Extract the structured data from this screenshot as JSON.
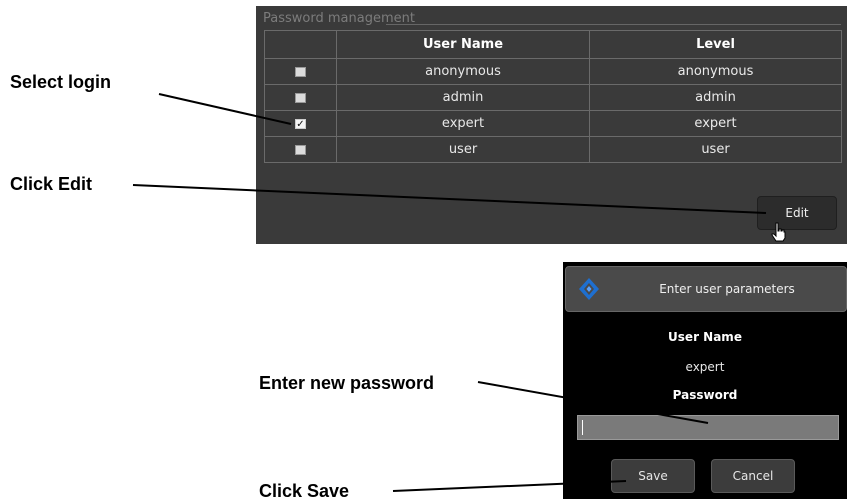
{
  "password_management": {
    "title": "Password management",
    "columns": [
      "User Name",
      "Level"
    ],
    "rows": [
      {
        "user": "anonymous",
        "level": "anonymous",
        "checked": false
      },
      {
        "user": "admin",
        "level": "admin",
        "checked": false
      },
      {
        "user": "expert",
        "level": "expert",
        "checked": true
      },
      {
        "user": "user",
        "level": "user",
        "checked": false
      }
    ],
    "edit_label": "Edit"
  },
  "dialog": {
    "title": "Enter user parameters",
    "user_name_label": "User Name",
    "user_name_value": "expert",
    "password_label": "Password",
    "password_value": "",
    "save_label": "Save",
    "cancel_label": "Cancel"
  },
  "annotations": {
    "select_login": "Select login",
    "click_edit": "Click Edit",
    "enter_new_password": "Enter new password",
    "click_save": "Click Save"
  },
  "icons": {
    "logo": "diamond-logo-icon",
    "cursor": "hand-pointer-icon",
    "check": "checkmark-icon"
  },
  "colors": {
    "panel_bg": "#3a3a3a",
    "dialog_bg": "#000000",
    "logo_blue": "#1e6fd0"
  }
}
